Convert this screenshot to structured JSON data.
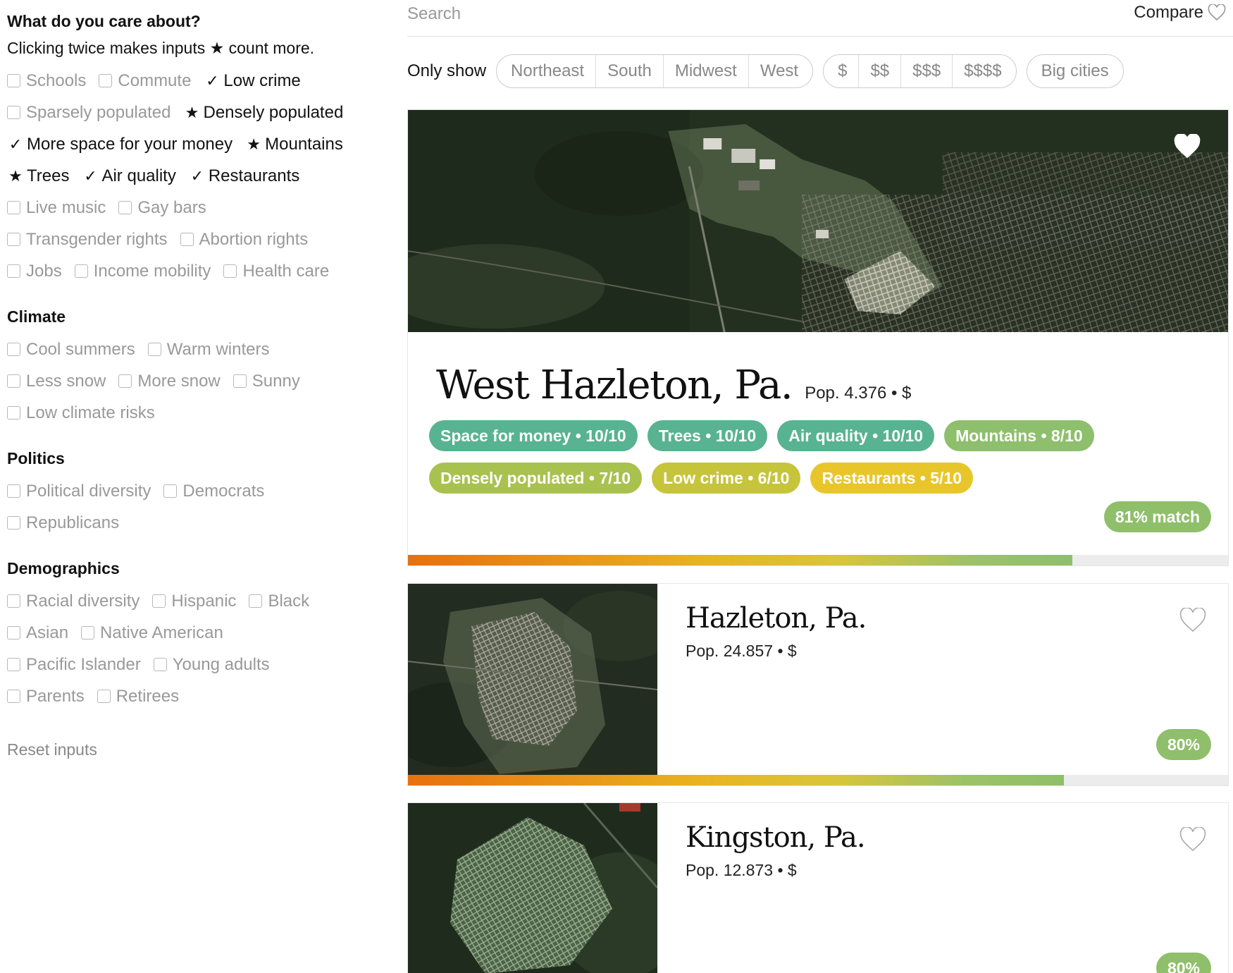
{
  "sidebar": {
    "heading": "What do you care about?",
    "subtext": "Clicking twice makes inputs ★ count more.",
    "rows": [
      [
        {
          "label": "Schools",
          "state": "off"
        },
        {
          "label": "Commute",
          "state": "off"
        },
        {
          "label": "Low crime",
          "state": "check"
        }
      ],
      [
        {
          "label": "Sparsely populated",
          "state": "off"
        },
        {
          "label": "Densely populated",
          "state": "star"
        }
      ],
      [
        {
          "label": "More space for your money",
          "state": "check"
        },
        {
          "label": "Mountains",
          "state": "star"
        }
      ],
      [
        {
          "label": "Trees",
          "state": "star"
        },
        {
          "label": "Air quality",
          "state": "check"
        },
        {
          "label": "Restaurants",
          "state": "check"
        }
      ],
      [
        {
          "label": "Live music",
          "state": "off"
        },
        {
          "label": "Gay bars",
          "state": "off"
        }
      ],
      [
        {
          "label": "Transgender rights",
          "state": "off"
        },
        {
          "label": "Abortion rights",
          "state": "off"
        }
      ],
      [
        {
          "label": "Jobs",
          "state": "off"
        },
        {
          "label": "Income mobility",
          "state": "off"
        },
        {
          "label": "Health care",
          "state": "off"
        }
      ]
    ],
    "sections": [
      {
        "title": "Climate",
        "rows": [
          [
            {
              "label": "Cool summers",
              "state": "off"
            },
            {
              "label": "Warm winters",
              "state": "off"
            }
          ],
          [
            {
              "label": "Less snow",
              "state": "off"
            },
            {
              "label": "More snow",
              "state": "off"
            },
            {
              "label": "Sunny",
              "state": "off"
            }
          ],
          [
            {
              "label": "Low climate risks",
              "state": "off"
            }
          ]
        ]
      },
      {
        "title": "Politics",
        "rows": [
          [
            {
              "label": "Political diversity",
              "state": "off"
            },
            {
              "label": "Democrats",
              "state": "off"
            }
          ],
          [
            {
              "label": "Republicans",
              "state": "off"
            }
          ]
        ]
      },
      {
        "title": "Demographics",
        "rows": [
          [
            {
              "label": "Racial diversity",
              "state": "off"
            },
            {
              "label": "Hispanic",
              "state": "off"
            },
            {
              "label": "Black",
              "state": "off"
            }
          ],
          [
            {
              "label": "Asian",
              "state": "off"
            },
            {
              "label": "Native American",
              "state": "off"
            }
          ],
          [
            {
              "label": "Pacific Islander",
              "state": "off"
            },
            {
              "label": "Young adults",
              "state": "off"
            }
          ],
          [
            {
              "label": "Parents",
              "state": "off"
            },
            {
              "label": "Retirees",
              "state": "off"
            }
          ]
        ]
      }
    ],
    "reset_label": "Reset inputs"
  },
  "search": {
    "placeholder": "Search"
  },
  "compare": {
    "label": "Compare",
    "icon": "heart-outline-icon"
  },
  "filters": {
    "label": "Only show",
    "regions": [
      "Northeast",
      "South",
      "Midwest",
      "West"
    ],
    "prices": [
      "$",
      "$$",
      "$$$",
      "$$$$"
    ],
    "extra": [
      "Big cities"
    ]
  },
  "cards": [
    {
      "name": "West Hazleton, Pa.",
      "pop": "Pop. 4.376 • $",
      "tags": [
        {
          "label": "Space for money • 10/10",
          "color": "#57b391"
        },
        {
          "label": "Trees • 10/10",
          "color": "#57b391"
        },
        {
          "label": "Air quality • 10/10",
          "color": "#57b391"
        },
        {
          "label": "Mountains • 8/10",
          "color": "#8dbf6c"
        },
        {
          "label": "Densely populated • 7/10",
          "color": "#a9c14f"
        },
        {
          "label": "Low crime • 6/10",
          "color": "#c6c43a"
        },
        {
          "label": "Restaurants • 5/10",
          "color": "#e8c62a"
        }
      ],
      "match": "81% match",
      "match_fraction": 0.81,
      "favorited": true
    },
    {
      "name": "Hazleton, Pa.",
      "pop": "Pop. 24.857 • $",
      "match": "80%",
      "match_fraction": 0.8,
      "favorited": false
    },
    {
      "name": "Kingston, Pa.",
      "pop": "Pop. 12.873 • $",
      "match": "80%",
      "match_fraction": 0.8,
      "favorited": false
    }
  ]
}
